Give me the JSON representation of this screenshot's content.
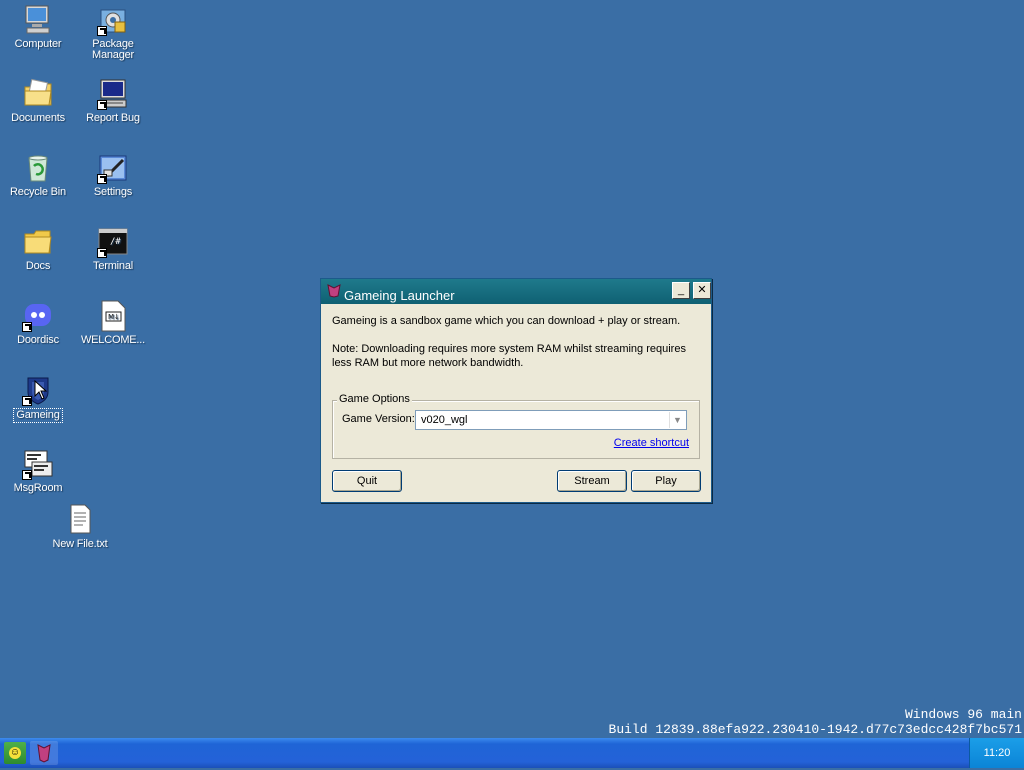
{
  "desktop": {
    "icons": [
      {
        "label": "Computer"
      },
      {
        "label": "Package Manager"
      },
      {
        "label": "Documents"
      },
      {
        "label": "Report Bug"
      },
      {
        "label": "Recycle Bin"
      },
      {
        "label": "Settings"
      },
      {
        "label": "Docs"
      },
      {
        "label": "Terminal"
      },
      {
        "label": "Doordisc"
      },
      {
        "label": "WELCOME..."
      },
      {
        "label": "Gameing"
      },
      {
        "label": "MsgRoom"
      },
      {
        "label": "New File.txt"
      }
    ],
    "terminal_glyph": "/#",
    "welcome_glyph": "M↓"
  },
  "window": {
    "title": "Gameing Launcher",
    "minimize": "_",
    "close": "✕",
    "intro": "Gameing is a sandbox game which you can download + play or stream.",
    "note": "Note: Downloading requires more system RAM whilst streaming requires less RAM but more network bandwidth.",
    "group_title": "Game Options",
    "version_label": "Game Version:",
    "version_value": "v020_wgl",
    "link": "Create shortcut",
    "quit": "Quit",
    "stream": "Stream",
    "play": "Play"
  },
  "build": {
    "line1": "Windows 96 main",
    "line2": "Build 12839.88efa922.230410-1942.d77c73edcc428f7bc571"
  },
  "taskbar": {
    "clock": "11:20",
    "start_glyph": "☺"
  },
  "colors": {
    "desktop": "#3a6ea5",
    "titlebar": "#0f6073",
    "taskbar": "#2462d8"
  }
}
